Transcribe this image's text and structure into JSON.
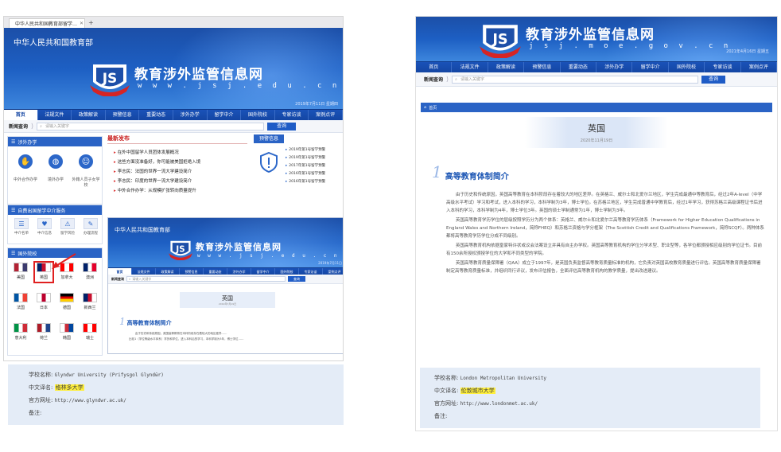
{
  "left": {
    "browser_tab": "中华人民共和国教育部留学…",
    "ministry": "中华人民共和国教育部",
    "site_title": "教育涉外监管信息网",
    "site_url": "w w w . j s j . e d u . c n",
    "date": "2019年7月11日  星期四",
    "nav": [
      "首页",
      "法规文件",
      "政策解读",
      "预警信息",
      "重要动态",
      "涉外办学",
      "留学中介",
      "国外院校",
      "专家访谈",
      "案例点评"
    ],
    "search_label": "新闻查询",
    "search_placeholder": "请输入关键字",
    "search_button": "查询",
    "box1_title": "涉外办学",
    "box1_items": [
      "中外合作办学",
      "境外办学",
      "外籍人员子女学校"
    ],
    "box2_title": "自费出国留学中介服务",
    "box2_items": [
      "中介名单",
      "中介信息",
      "留学风险",
      "办理流程",
      "纠纷调解",
      "服务规范"
    ],
    "box3_title": "国外院校",
    "countries": [
      "美国",
      "英国",
      "加拿大",
      "澳洲",
      "法国",
      "日本",
      "德国",
      "新西兰",
      "意大利",
      "荷兰",
      "韩国",
      "瑞士"
    ],
    "news_title": "最新发布",
    "news": [
      "在外中国留学人员团体发展概况",
      "这些方面没准备好，你可能被美国拒绝入境",
      "李志民：法国的世界一流大学建设简介",
      "李志民：印度的世界一流大学建设简介",
      "中外合作办学：从规模扩张转向质量提升"
    ],
    "alert_title": "预警信息",
    "alerts": [
      "2019年第1号留学预警",
      "2019年第1号留学预警",
      "2017年第1号留学预警",
      "2016年第1号留学预警",
      "2016年第1号留学预警"
    ],
    "inset": {
      "ministry": "中华人民共和国教育部",
      "site_title": "教育涉外监管信息网",
      "site_url": "w w w . j s j . e d u . c n",
      "date": "2019年7月11日",
      "nav": [
        "首页",
        "法规文件",
        "政策解读",
        "预警信息",
        "重要动态",
        "涉外办学",
        "留学中介",
        "国外院校",
        "专家访谈",
        "案例点评"
      ],
      "search_label": "新闻查询",
      "search_placeholder": "请输入关键字",
      "search_button": "查询",
      "country": "英国",
      "date2": "2019年7月19日",
      "section_num": "1",
      "section_title": "高等教育体制简介",
      "text1": "由于历史和传统原因，英国高等教育在本科阶段存在着较大的地区差异……",
      "text2": "比较1（学位等级水平体系）学历和学位，进入本科后的学习，本科学制为3年，博士学位……"
    },
    "info": {
      "name_label": "学校名称:",
      "name_value": "Glyndwr University (Prifysgol Glyndŵr)",
      "cn_label": "中文译名:",
      "cn_value": "格林多大学",
      "web_label": "官方网址:",
      "web_value": "http://www.glyndwr.ac.uk/",
      "note_label": "备注:"
    }
  },
  "right": {
    "site_title": "教育涉外监管信息网",
    "site_url": "j s j . m o e . g o v . c n",
    "date": "2021年4月16日  星期五",
    "nav": [
      "首页",
      "法规文件",
      "政策解读",
      "预警信息",
      "重要动态",
      "涉外办学",
      "留学中介",
      "国外院校",
      "专家访谈",
      "案例点评"
    ],
    "search_label": "新闻查询",
    "search_placeholder": "请输入关键字",
    "search_button": "查询",
    "crumb": "首页",
    "country": "英国",
    "country_date": "2020年11月19日",
    "section_num": "1",
    "section_title": "高等教育体制简介",
    "paragraphs": [
      "由于历史和传统原因，英国高等教育在本科阶段存在着较大的地区差异。在英格兰、威尔士和北爱尔兰地区，学生完成最通中等教育后，经过2年A-level（中学高级水平考试）学习和考试，进入本科的学习，本科学制为3年，博士学位。在苏格兰地区，学生完成普通中学教育后，经过1年学习，获得苏格兰高级课程证书后进入本科的学习，本科学制为4年，博士学位3年。英国的硕士学制通常为1年，博士学制为3年。",
      "英国高等教育学历学位的层级按照学历分为两个体系：英格兰、威尔士和北爱尔兰高等教育学历体系（Framework for Higher Education Qualifications in England Wales and Northern Ireland，简称FHEQ）和苏格兰资格与学分框架（The Scottish Credit and Qualifications Framework，简称SCQF）。两种体系都将高等教育学历学位分成不同级别。",
      "英国高等教育机构依据皇家特许状或议会法案设立并具有自主办学权。英国高等教育机构的学位分学术型、职业型等，各学位都颁授相应级别的学位证书。目前有150余所授权颁授学位的大学和不同类型的学院。",
      "英国高等教育质量保障署（QAA）成立于1997年，是英国负责监督高等教育质量标准的机构，它负责对英国高校教育质量进行评估。英国高等教育质量保障署制定高等教育质量标准，并组织同行评议，发布评估报告，全面评估高等教育机构的教学质量，提出改进建议。"
    ],
    "info": {
      "name_label": "学校名称:",
      "name_value": "London Metropolitan University",
      "cn_label": "中文译名:",
      "cn_value": "伦敦城市大学",
      "web_label": "官方网址:",
      "web_value": "http://www.londonmet.ac.uk/",
      "note_label": "备注:"
    }
  },
  "colors": {
    "brand_blue": "#1d5fc3",
    "nav_blue": "#1446a3",
    "highlight": "#ffef3a",
    "arrow_red": "#e02020"
  }
}
